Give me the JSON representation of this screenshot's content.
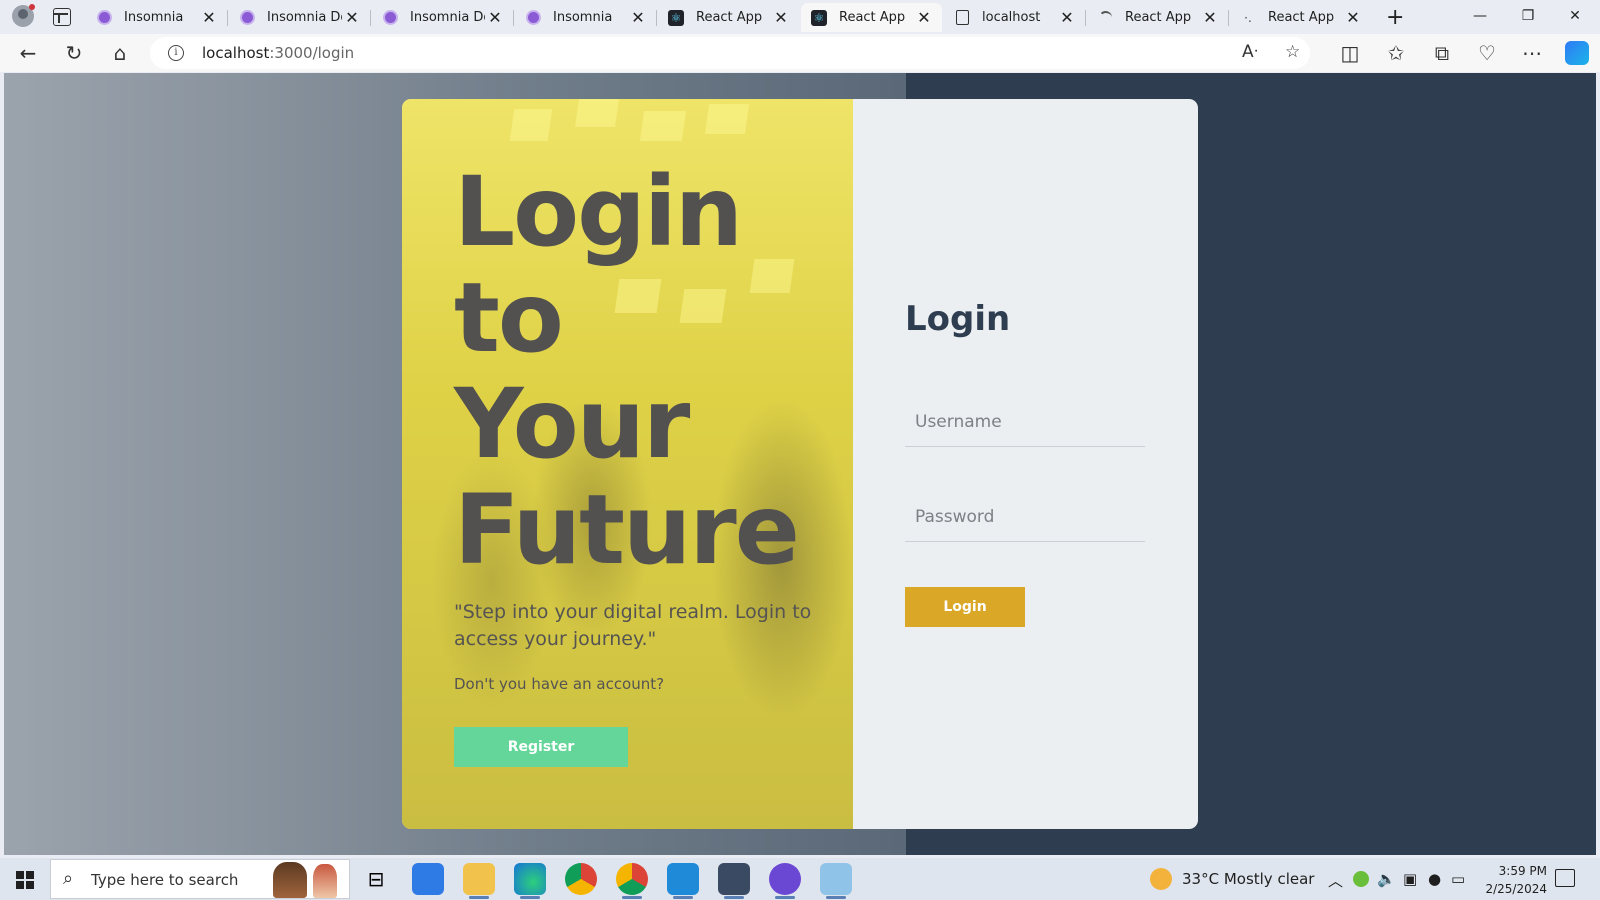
{
  "browser": {
    "tabs": [
      {
        "title": "Insomnia",
        "icon": "insomnia-icon",
        "active": false
      },
      {
        "title": "Insomnia Doc",
        "icon": "insomnia-icon",
        "active": false
      },
      {
        "title": "Insomnia Doc",
        "icon": "insomnia-icon",
        "active": false
      },
      {
        "title": "Insomnia",
        "icon": "insomnia-icon",
        "active": false
      },
      {
        "title": "React App",
        "icon": "react-icon",
        "active": false
      },
      {
        "title": "React App",
        "icon": "react-icon",
        "active": true
      },
      {
        "title": "localhost",
        "icon": "page-icon",
        "active": false
      },
      {
        "title": "React App",
        "icon": "loading-icon",
        "active": false
      },
      {
        "title": "React App",
        "icon": "loading-icon",
        "active": false
      }
    ],
    "close_glyph": "✕",
    "new_tab_glyph": "+",
    "url_host": "localhost",
    "url_path": ":3000/login"
  },
  "page": {
    "headline": [
      "Login",
      "to",
      "Your",
      "Future"
    ],
    "quote": "\"Step into your digital realm. Login to access your journey.\"",
    "no_account": "Don't you have an account?",
    "register_label": "Register",
    "form_title": "Login",
    "username_placeholder": "Username",
    "password_placeholder": "Password",
    "login_label": "Login"
  },
  "taskbar": {
    "search_placeholder": "Type here to search",
    "weather": "33°C  Mostly clear",
    "time": "3:59 PM",
    "date": "2/25/2024"
  },
  "colors": {
    "promo_yellow": "#e6d84a",
    "register_green": "#64d69a",
    "login_gold": "#dba726",
    "navy": "#2e3d50"
  }
}
